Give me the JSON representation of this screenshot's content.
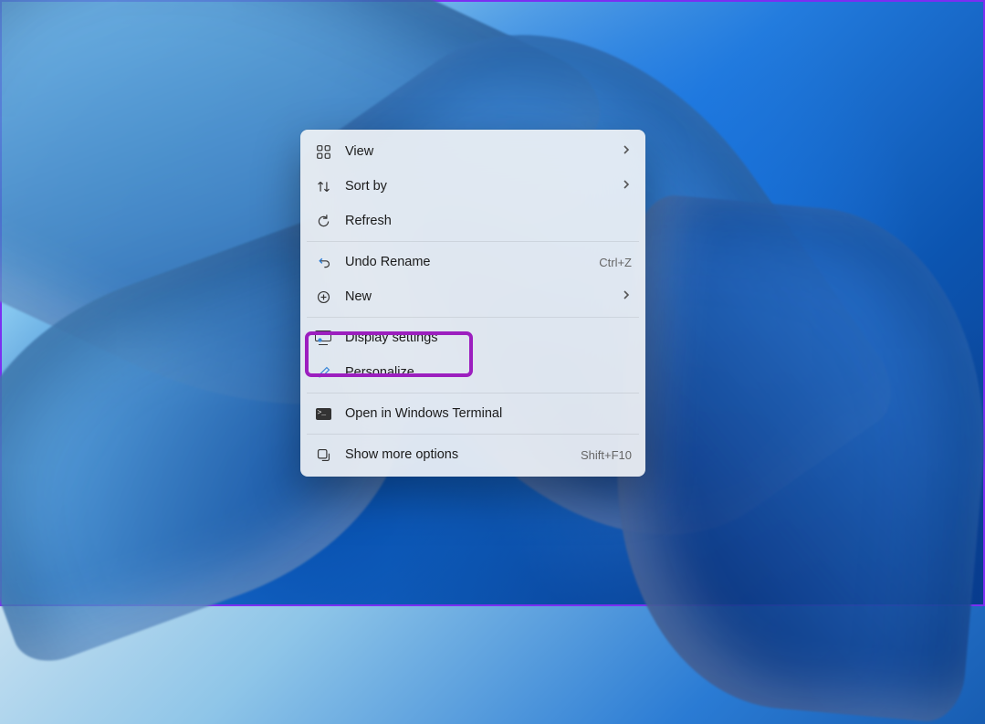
{
  "highlight_color": "#9c1fbf",
  "context_menu": {
    "groups": [
      [
        {
          "id": "view",
          "label": "View",
          "submenu": true
        },
        {
          "id": "sort",
          "label": "Sort by",
          "submenu": true
        },
        {
          "id": "refresh",
          "label": "Refresh"
        }
      ],
      [
        {
          "id": "undo",
          "label": "Undo Rename",
          "accel": "Ctrl+Z"
        },
        {
          "id": "new",
          "label": "New",
          "submenu": true
        }
      ],
      [
        {
          "id": "display",
          "label": "Display settings",
          "highlighted": true
        },
        {
          "id": "personalize",
          "label": "Personalize"
        }
      ],
      [
        {
          "id": "terminal",
          "label": "Open in Windows Terminal"
        }
      ],
      [
        {
          "id": "more",
          "label": "Show more options",
          "accel": "Shift+F10"
        }
      ]
    ]
  }
}
